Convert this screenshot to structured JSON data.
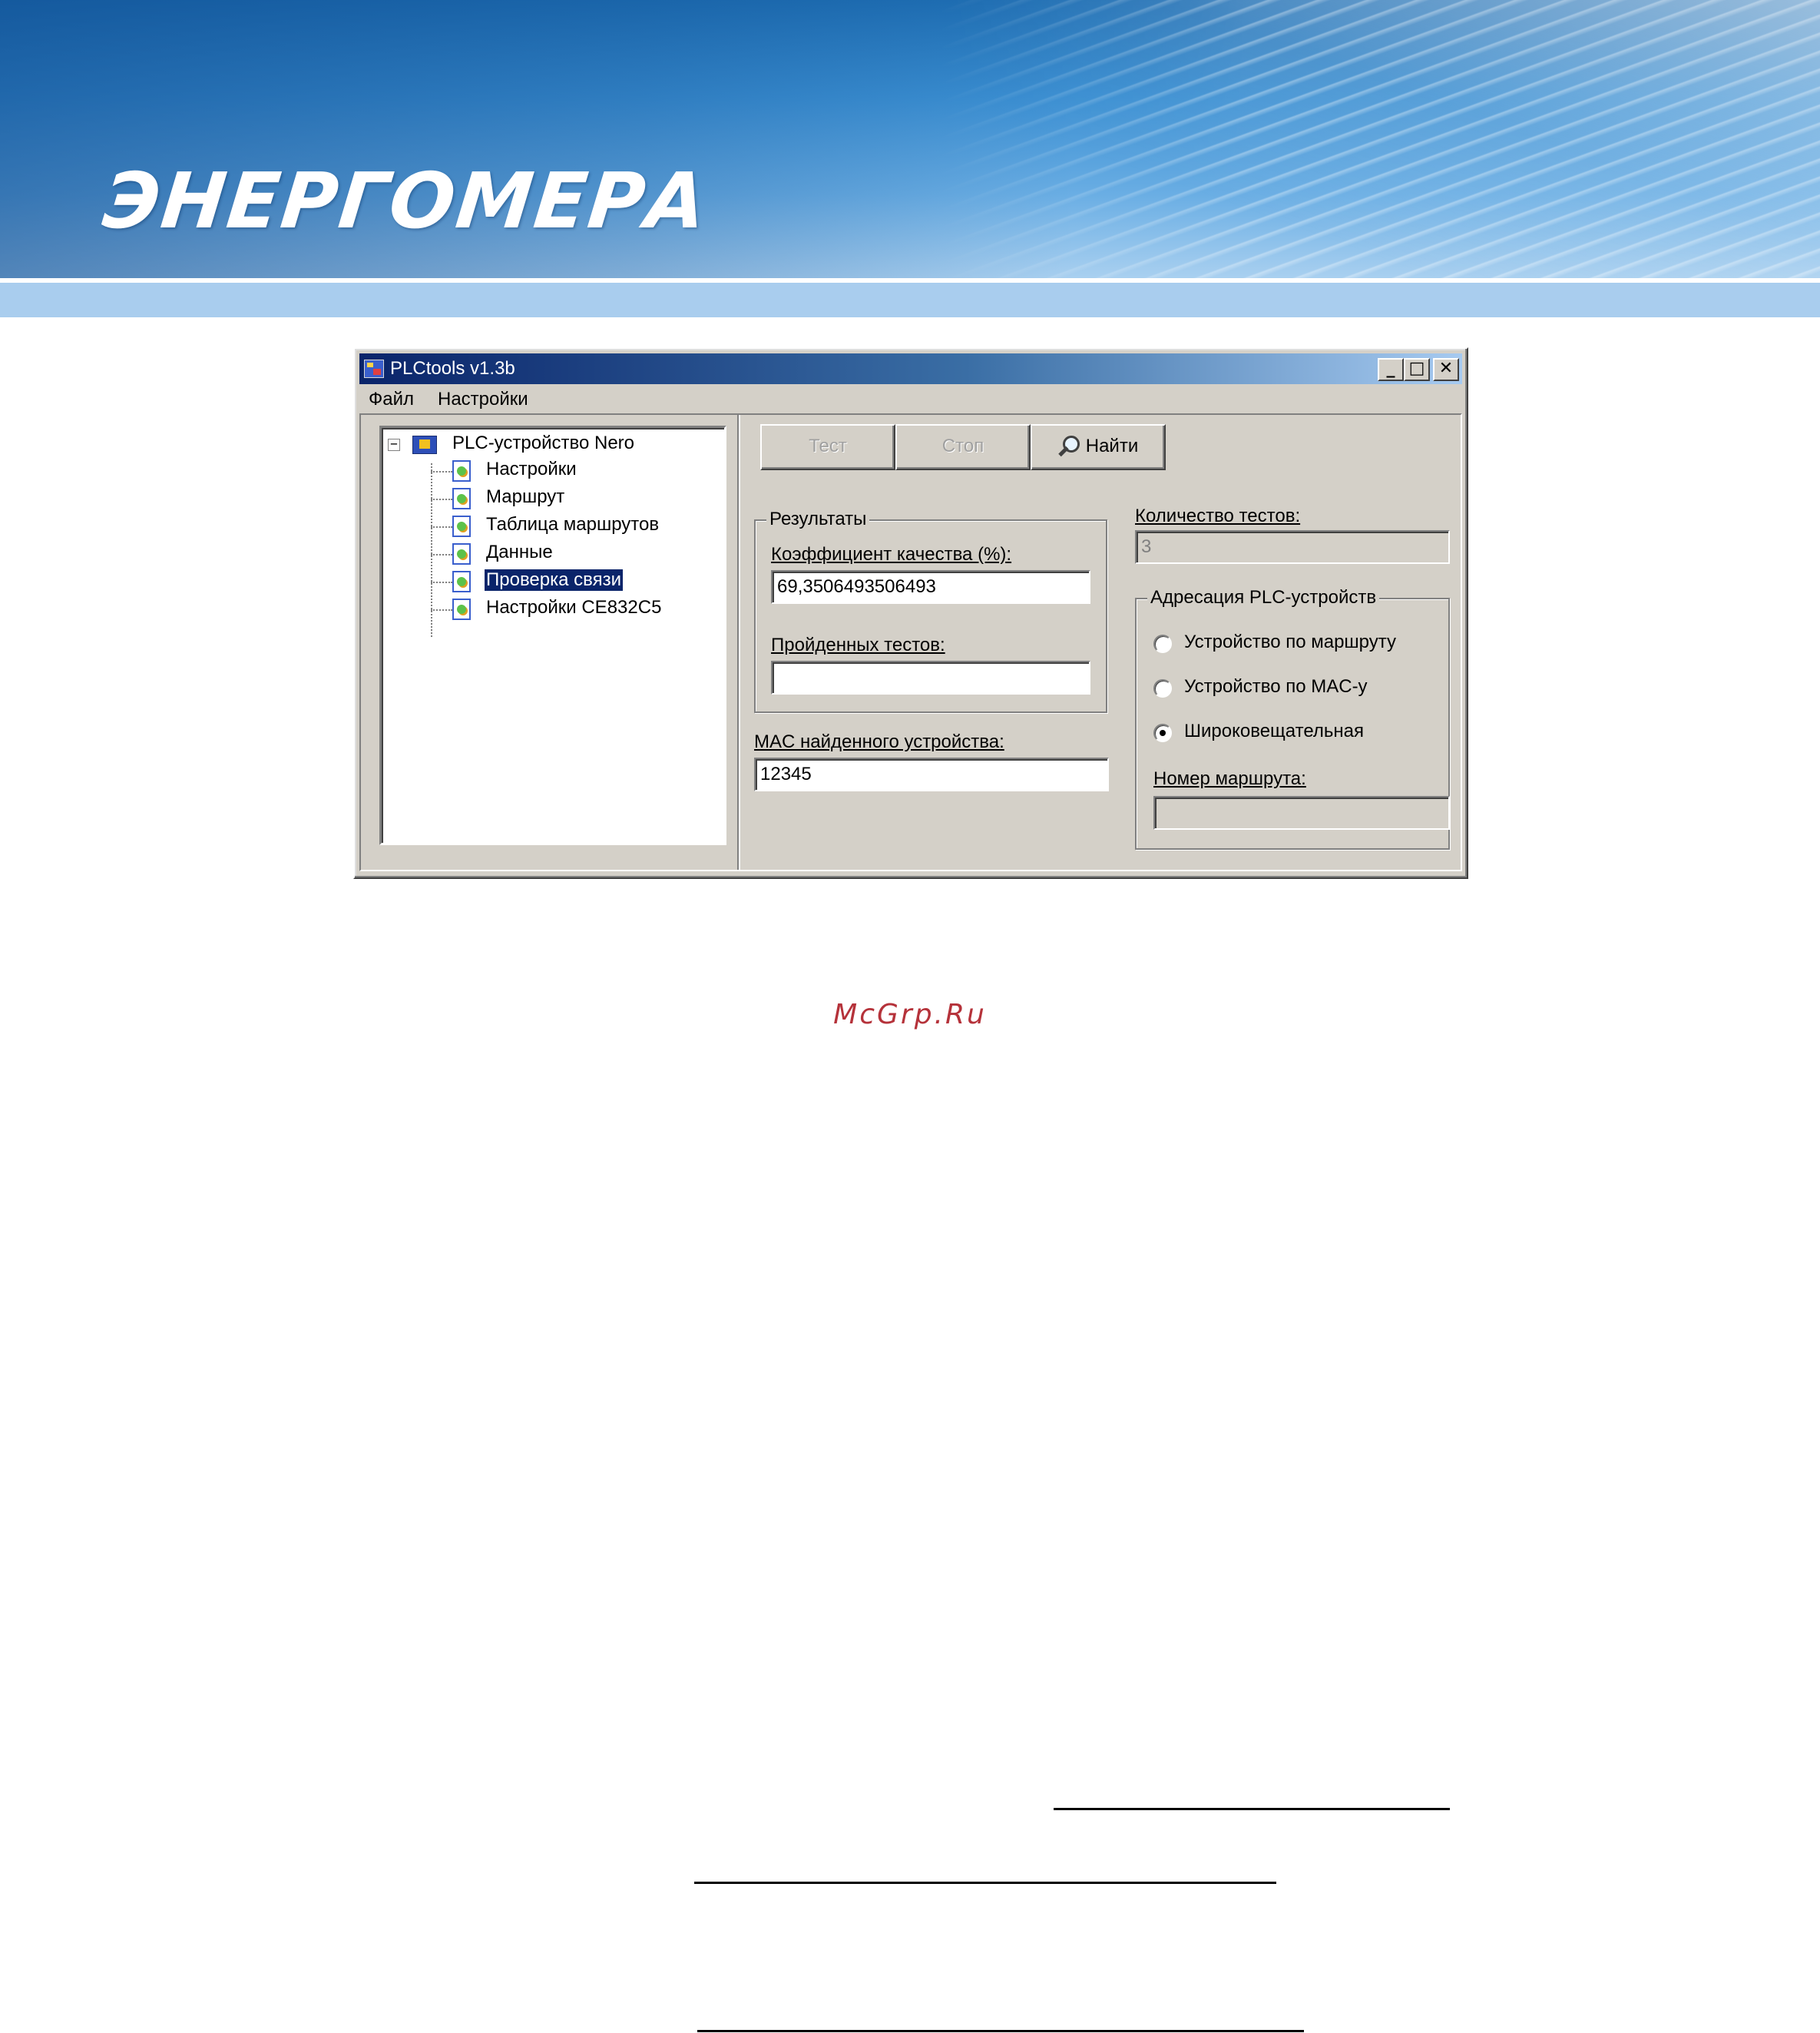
{
  "banner": {
    "logo_text": "ЭНЕРГОМЕРА"
  },
  "window": {
    "title": "PLCtools v1.3b",
    "controls": {
      "minimize": "_",
      "maximize": "□",
      "close": "✕"
    },
    "menu": [
      "Файл",
      "Настройки"
    ]
  },
  "tree": {
    "root_label": "PLC-устройство Nero",
    "expander": "−",
    "items": [
      {
        "label": "Настройки"
      },
      {
        "label": "Маршрут"
      },
      {
        "label": "Таблица маршрутов"
      },
      {
        "label": "Данные"
      },
      {
        "label": "Проверка связи",
        "selected": true
      },
      {
        "label": "Настройки CE832C5"
      }
    ]
  },
  "toolbar": {
    "test_label": "Тест",
    "stop_label": "Стоп",
    "find_label": "Найти",
    "find_icon": "search-icon"
  },
  "results": {
    "group_title": "Результаты",
    "quality_label": "Коэффициент качества (%):",
    "quality_value": "69,3506493506493",
    "passed_label": "Пройденных тестов:",
    "passed_value": ""
  },
  "mac": {
    "label": "MAC найденного устройства:",
    "value": "12345"
  },
  "tests_count": {
    "label": "Количество тестов:",
    "value": "3"
  },
  "addressing": {
    "group_title": "Адресация PLC-устройств",
    "options": [
      {
        "label": "Устройство по маршруту",
        "checked": false
      },
      {
        "label": "Устройство по MAC-у",
        "checked": false
      },
      {
        "label": "Широковещательная",
        "checked": true
      }
    ],
    "route_label": "Номер маршрута:",
    "route_value": ""
  },
  "watermark": "McGrp.Ru",
  "colors": {
    "window_bg": "#d4d0c8",
    "title_start": "#0a246a",
    "title_end": "#a6caf0",
    "selection": "#0a246a",
    "watermark": "#b5323a",
    "banner_blue": "#1f6fb4"
  }
}
